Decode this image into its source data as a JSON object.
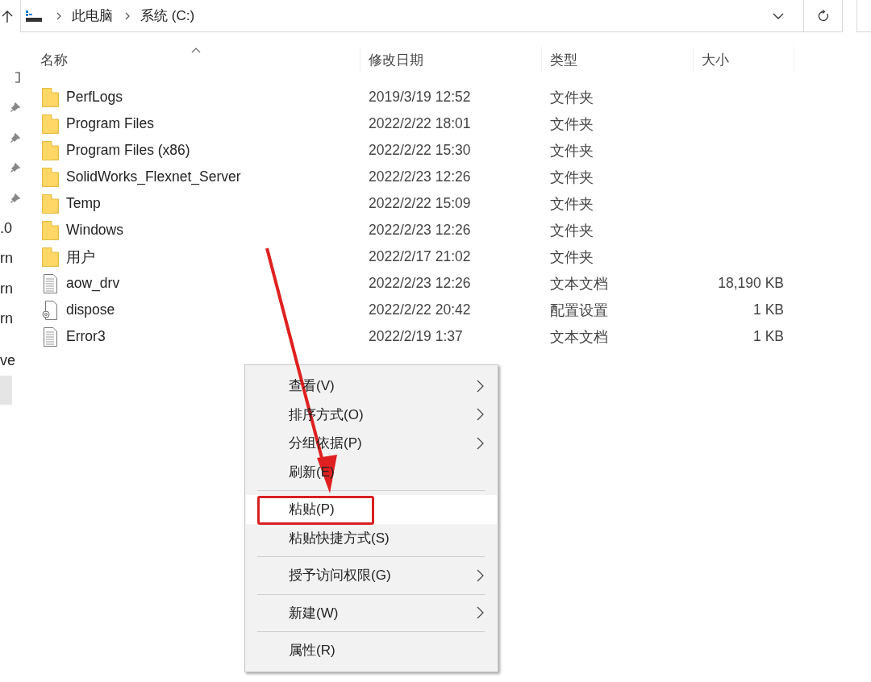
{
  "address_bar": {
    "path": [
      {
        "label": "此电脑"
      },
      {
        "label": "系统 (C:)"
      }
    ]
  },
  "sidebar": {
    "items": [
      {
        "kind": "icon",
        "selected": false
      },
      {
        "kind": "pinned",
        "selected": false
      },
      {
        "kind": "pinned",
        "selected": false
      },
      {
        "kind": "pinned",
        "selected": false
      },
      {
        "kind": "pinned",
        "selected": false
      },
      {
        "kind": "label",
        "label": ".0",
        "selected": false
      },
      {
        "kind": "label",
        "label": "rn",
        "selected": false
      },
      {
        "kind": "label",
        "label": "rn",
        "selected": false
      },
      {
        "kind": "label",
        "label": "rn",
        "selected": false
      },
      {
        "kind": "label",
        "label": "ve",
        "selected": false
      },
      {
        "kind": "blank",
        "selected": true
      }
    ]
  },
  "columns": [
    {
      "label": "名称",
      "sorted": true
    },
    {
      "label": "修改日期",
      "sorted": false
    },
    {
      "label": "类型",
      "sorted": false
    },
    {
      "label": "大小",
      "sorted": false
    }
  ],
  "rows": [
    {
      "kind": "folder",
      "name": "PerfLogs",
      "date": "2019/3/19 12:52",
      "type": "文件夹"
    },
    {
      "kind": "folder",
      "name": "Program Files",
      "date": "2022/2/22 18:01",
      "type": "文件夹"
    },
    {
      "kind": "folder",
      "name": "Program Files (x86)",
      "date": "2022/2/22 15:30",
      "type": "文件夹"
    },
    {
      "kind": "folder",
      "name": "SolidWorks_Flexnet_Server",
      "date": "2022/2/23 12:26",
      "type": "文件夹"
    },
    {
      "kind": "folder",
      "name": "Temp",
      "date": "2022/2/22 15:09",
      "type": "文件夹"
    },
    {
      "kind": "folder",
      "name": "Windows",
      "date": "2022/2/23 12:26",
      "type": "文件夹"
    },
    {
      "kind": "folder",
      "name": "用户",
      "date": "2022/2/17 21:02",
      "type": "文件夹"
    },
    {
      "kind": "text",
      "name": "aow_drv",
      "date": "2022/2/23 12:26",
      "type": "文本文档",
      "size": "18,190 KB"
    },
    {
      "kind": "config",
      "name": "dispose",
      "date": "2022/2/22 20:42",
      "type": "配置设置",
      "size": "1 KB"
    },
    {
      "kind": "text",
      "name": "Error3",
      "date": "2022/2/19 1:37",
      "type": "文本文档",
      "size": "1 KB"
    }
  ],
  "context_menu": {
    "items": [
      {
        "kind": "item",
        "label": "查看(V)",
        "submenu": true,
        "hovered": false,
        "outlined": false
      },
      {
        "kind": "item",
        "label": "排序方式(O)",
        "submenu": true,
        "hovered": false,
        "outlined": false
      },
      {
        "kind": "item",
        "label": "分组依据(P)",
        "submenu": true,
        "hovered": false,
        "outlined": false
      },
      {
        "kind": "item",
        "label": "刷新(E)",
        "submenu": false,
        "hovered": false,
        "outlined": false
      },
      {
        "kind": "separator"
      },
      {
        "kind": "item",
        "label": "粘贴(P)",
        "submenu": false,
        "hovered": true,
        "outlined": true
      },
      {
        "kind": "item",
        "label": "粘贴快捷方式(S)",
        "submenu": false,
        "hovered": false,
        "outlined": false
      },
      {
        "kind": "separator"
      },
      {
        "kind": "item",
        "label": "授予访问权限(G)",
        "submenu": true,
        "hovered": false,
        "outlined": false
      },
      {
        "kind": "separator"
      },
      {
        "kind": "item",
        "label": "新建(W)",
        "submenu": true,
        "hovered": false,
        "outlined": false
      },
      {
        "kind": "separator"
      },
      {
        "kind": "item",
        "label": "属性(R)",
        "submenu": false,
        "hovered": false,
        "outlined": false
      }
    ]
  }
}
